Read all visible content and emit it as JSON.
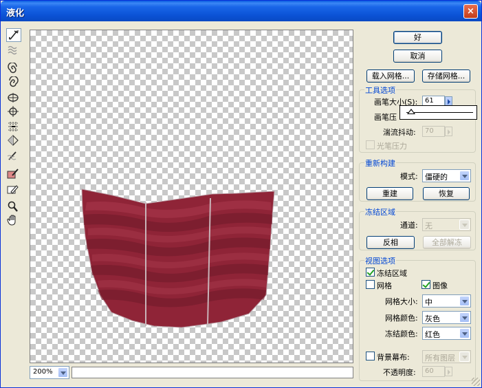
{
  "window": {
    "title": "液化",
    "close_glyph": "×"
  },
  "toolbar": {
    "tools": [
      {
        "name": "forward-warp-icon"
      },
      {
        "name": "reconstruct-icon"
      },
      {
        "name": "twirl-clockwise-icon"
      },
      {
        "name": "twirl-counterclockwise-icon"
      },
      {
        "name": "pucker-icon"
      },
      {
        "name": "bloat-icon"
      },
      {
        "name": "push-left-icon"
      },
      {
        "name": "mirror-icon"
      },
      {
        "name": "turbulence-icon"
      },
      {
        "name": "freeze-mask-icon"
      },
      {
        "name": "thaw-mask-icon"
      },
      {
        "name": "zoom-icon"
      },
      {
        "name": "hand-icon"
      }
    ]
  },
  "actions": {
    "ok": "好",
    "cancel": "取消",
    "load_mesh": "载入网格...",
    "save_mesh": "存储网格..."
  },
  "tool_options": {
    "title": "工具选项",
    "brush_size_label": "画笔大小(S):",
    "brush_size_value": "61",
    "brush_pressure_label": "画笔压",
    "turbulent_jitter_label": "湍流抖动:",
    "turbulent_jitter_value": "70",
    "stylus_pressure_label": "光笔压力"
  },
  "reconstruct": {
    "title": "重新构建",
    "mode_label": "模式:",
    "mode_value": "僵硬的",
    "reconstruct_button": "重建",
    "restore_button": "恢复"
  },
  "freeze_area": {
    "title": "冻结区域",
    "channel_label": "通道:",
    "channel_value": "无",
    "invert_button": "反相",
    "thaw_all_button": "全部解冻"
  },
  "view_options": {
    "title": "视图选项",
    "freeze_area_label": "冻结区域",
    "freeze_area_checked": true,
    "mesh_label": "网格",
    "mesh_checked": false,
    "image_label": "图像",
    "image_checked": true,
    "mesh_size_label": "网格大小:",
    "mesh_size_value": "中",
    "mesh_color_label": "网格颜色:",
    "mesh_color_value": "灰色",
    "freeze_color_label": "冻结颜色:",
    "freeze_color_value": "红色",
    "backdrop_label": "背景幕布:",
    "backdrop_checked": false,
    "backdrop_value": "所有图层",
    "opacity_label": "不透明度:",
    "opacity_value": "60"
  },
  "footer": {
    "zoom_value": "200%"
  },
  "colors": {
    "title_bar": "#0b53d6",
    "group_title": "#0046d5",
    "shape_fill": "#8f2437",
    "shape_highlight": "#a8374b",
    "shape_shadow": "#6f1a2a"
  }
}
